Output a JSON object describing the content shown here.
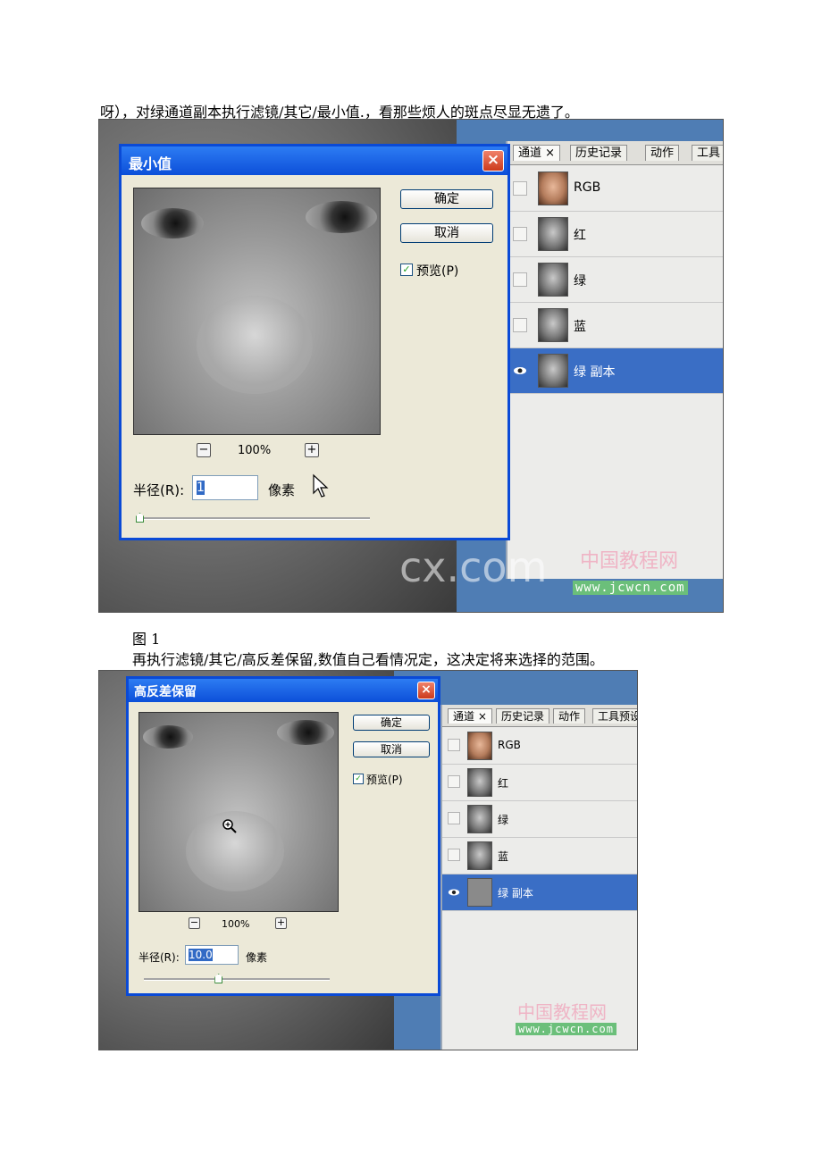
{
  "text": {
    "line1": "呀），对绿通道副本执行滤镜/其它/最小值.，看那些烦人的斑点尽显无遗了。",
    "caption1": "图 1",
    "line2": "再执行滤镜/其它/高反差保留,数值自己看情况定，这决定将来选择的范围。"
  },
  "fig1": {
    "dialog": {
      "title": "最小值",
      "close": "×",
      "ok": "确定",
      "cancel": "取消",
      "preview_check": "✓",
      "preview_label": "预览(P)",
      "zoom_out": "−",
      "zoom_in": "+",
      "zoom": "100%",
      "radius_label": "半径(R):",
      "radius_value": "1",
      "unit": "像素",
      "slider_level": 0
    },
    "panel": {
      "tabs": [
        "通道 ×",
        "历史记录",
        "动作",
        "工具"
      ],
      "channels": [
        "RGB",
        "红",
        "绿",
        "蓝",
        "绿 副本"
      ]
    },
    "watermark": {
      "big": "cx.com",
      "cn": "中国教程网",
      "url": "www.jcwcn.com"
    }
  },
  "fig2": {
    "dialog": {
      "title": "高反差保留",
      "close": "×",
      "ok": "确定",
      "cancel": "取消",
      "preview_check": "✓",
      "preview_label": "预览(P)",
      "zoom_out": "−",
      "zoom_in": "+",
      "zoom": "100%",
      "radius_label": "半径(R):",
      "radius_value": "10.0",
      "unit": "像素",
      "slider_level": 0.4
    },
    "panel": {
      "tabs": [
        "通道 ×",
        "历史记录",
        "动作",
        "工具预设"
      ],
      "channels": [
        "RGB",
        "红",
        "绿",
        "蓝",
        "绿 副本"
      ]
    },
    "watermark": {
      "cn": "中国教程网",
      "url": "www.jcwcn.com"
    }
  },
  "colors": {
    "dialog_border": "#0a4ad6",
    "selection": "#3a6ec5",
    "close": "#cc3a1c",
    "preview_check": "#21a121"
  }
}
